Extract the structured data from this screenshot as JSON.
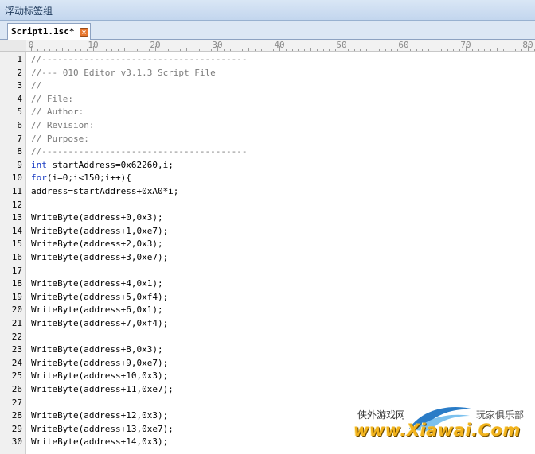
{
  "panel": {
    "title": "浮动标签组"
  },
  "tab": {
    "label": "Script1.1sc*",
    "close_icon": "close-icon"
  },
  "ruler": {
    "labels": [
      "0",
      "10",
      "20",
      "30",
      "40",
      "50",
      "60",
      "70",
      "80"
    ]
  },
  "editor": {
    "lines": [
      {
        "n": "1",
        "type": "comment",
        "text": "//---------------------------------------"
      },
      {
        "n": "2",
        "type": "comment",
        "text": "//--- 010 Editor v3.1.3 Script File"
      },
      {
        "n": "3",
        "type": "comment",
        "text": "//"
      },
      {
        "n": "4",
        "type": "comment",
        "text": "// File:"
      },
      {
        "n": "5",
        "type": "comment",
        "text": "// Author:"
      },
      {
        "n": "6",
        "type": "comment",
        "text": "// Revision:"
      },
      {
        "n": "7",
        "type": "comment",
        "text": "// Purpose:"
      },
      {
        "n": "8",
        "type": "comment",
        "text": "//---------------------------------------"
      },
      {
        "n": "9",
        "type": "kw",
        "kw": "int",
        "text": " startAddress=0x62260,i;"
      },
      {
        "n": "10",
        "type": "kw",
        "kw": "for",
        "text": "(i=0;i<150;i++){"
      },
      {
        "n": "11",
        "type": "plain",
        "text": "address=startAddress+0xA0*i;"
      },
      {
        "n": "12",
        "type": "plain",
        "text": ""
      },
      {
        "n": "13",
        "type": "plain",
        "text": "WriteByte(address+0,0x3);"
      },
      {
        "n": "14",
        "type": "plain",
        "text": "WriteByte(address+1,0xe7);"
      },
      {
        "n": "15",
        "type": "plain",
        "text": "WriteByte(address+2,0x3);"
      },
      {
        "n": "16",
        "type": "plain",
        "text": "WriteByte(address+3,0xe7);"
      },
      {
        "n": "17",
        "type": "plain",
        "text": ""
      },
      {
        "n": "18",
        "type": "plain",
        "text": "WriteByte(address+4,0x1);"
      },
      {
        "n": "19",
        "type": "plain",
        "text": "WriteByte(address+5,0xf4);"
      },
      {
        "n": "20",
        "type": "plain",
        "text": "WriteByte(address+6,0x1);"
      },
      {
        "n": "21",
        "type": "plain",
        "text": "WriteByte(address+7,0xf4);"
      },
      {
        "n": "22",
        "type": "plain",
        "text": ""
      },
      {
        "n": "23",
        "type": "plain",
        "text": "WriteByte(address+8,0x3);"
      },
      {
        "n": "24",
        "type": "plain",
        "text": "WriteByte(address+9,0xe7);"
      },
      {
        "n": "25",
        "type": "plain",
        "text": "WriteByte(address+10,0x3);"
      },
      {
        "n": "26",
        "type": "plain",
        "text": "WriteByte(address+11,0xe7);"
      },
      {
        "n": "27",
        "type": "plain",
        "text": ""
      },
      {
        "n": "28",
        "type": "plain",
        "text": "WriteByte(address+12,0x3);"
      },
      {
        "n": "29",
        "type": "plain",
        "text": "WriteByte(address+13,0xe7);"
      },
      {
        "n": "30",
        "type": "plain",
        "text": "WriteByte(address+14,0x3);"
      }
    ]
  },
  "watermark": {
    "left_text": "侠外游戏网",
    "right_text": "玩家俱乐部",
    "logo_text": "www.Xiawai.Com"
  },
  "colors": {
    "comment": "#7a7a7a",
    "keyword": "#1a3cc4",
    "tab_close": "#e8772e"
  }
}
